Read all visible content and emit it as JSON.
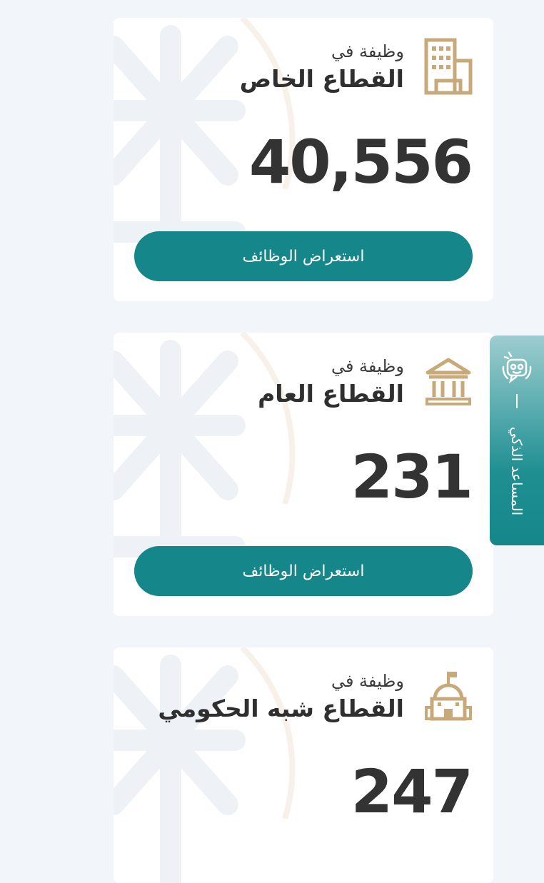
{
  "cards": [
    {
      "subtitle": "وظيفة في",
      "title": "القطاع الخاص",
      "count": "40,556",
      "button_label": "استعراض الوظائف",
      "icon": "office-building-icon"
    },
    {
      "subtitle": "وظيفة في",
      "title": "القطاع العام",
      "count": "231",
      "button_label": "استعراض الوظائف",
      "icon": "government-building-icon"
    },
    {
      "subtitle": "وظيفة في",
      "title": "القطاع شبه الحكومي",
      "count": "247",
      "icon": "semi-government-building-icon"
    }
  ],
  "assistant": {
    "label": "المساعد الذكي",
    "icon": "robot-icon"
  },
  "colors": {
    "accent": "#15878a",
    "icon_gold": "#c8a97a",
    "background": "#f2f5f9"
  }
}
